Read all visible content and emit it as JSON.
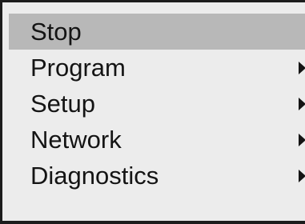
{
  "menu": {
    "items": [
      {
        "label": "Stop",
        "selected": true,
        "has_submenu": false
      },
      {
        "label": "Program",
        "selected": false,
        "has_submenu": true,
        "submenu_icon": "triangle-right-icon"
      },
      {
        "label": "Setup",
        "selected": false,
        "has_submenu": true,
        "submenu_icon": "triangle-right-icon"
      },
      {
        "label": "Network",
        "selected": false,
        "has_submenu": true,
        "submenu_icon": "triangle-right-icon"
      },
      {
        "label": "Diagnostics",
        "selected": false,
        "has_submenu": true,
        "submenu_icon": "triangle-right-icon"
      }
    ],
    "colors": {
      "background": "#ececec",
      "highlight": "#b8b8b8",
      "text": "#141414",
      "frame": "#1c1c1c"
    }
  }
}
